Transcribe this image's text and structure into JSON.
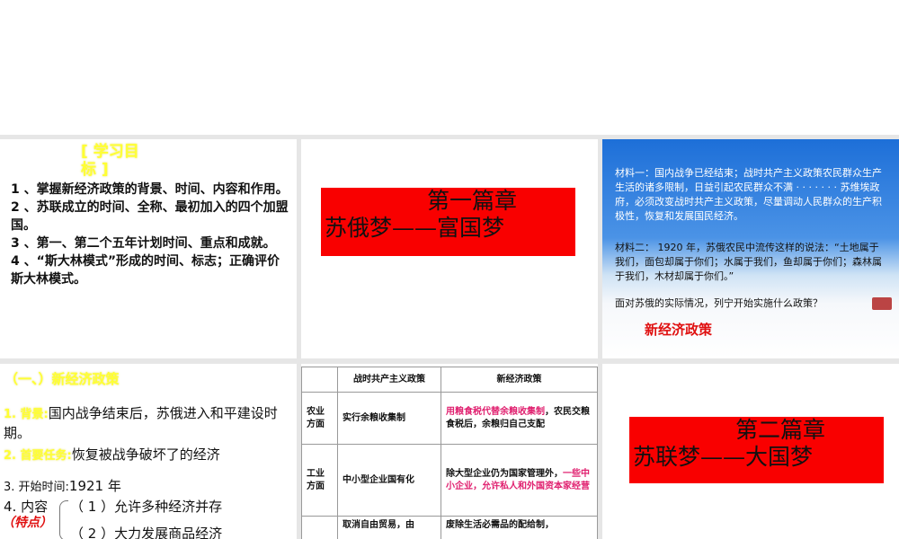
{
  "slide1": {
    "title": "[ 学习目标 ]",
    "goals": [
      "1 、掌握新经济政策的背景、时间、内容和作用。",
      "2 、苏联成立的时间、全称、最初加入的四个加盟国。",
      "3 、第一、第二个五年计划时间、重点和成就。",
      "4 、“斯大林模式”形成的时间、标志；正确评价斯大林模式。"
    ]
  },
  "slide2": {
    "line1": "第一篇章",
    "line2": "苏俄梦——富国梦"
  },
  "slide3": {
    "material1": "材料一：国内战争已经结束；战时共产主义政策农民群众生产生活的诸多限制，日益引起农民群众不满 · · · · · · · 苏维埃政府，必须改变战时共产主义政策，尽量调动人民群众的生产积极性，恢复和发展国民经济。",
    "material2": "材料二： 1920 年，苏俄农民中流传这样的说法：“土地属于我们，面包却属于你们；水属于我们，鱼却属于你们；森林属于我们，木材却属于你们。”",
    "question": "面对苏俄的实际情况，列宁开始实施什么政策？",
    "answer": "新经济政策"
  },
  "slide4": {
    "heading": "（一、）新经济政策",
    "bg_label": "1. 背景:",
    "bg_text": "国内战争结束后，苏俄进入和平建设时期。",
    "task_label": "2. 首要任务:",
    "task_text": "恢复被战争破坏了的经济",
    "start_label": "3. 开始时间:",
    "start_text": "1921 年",
    "content_label": "4. 内容",
    "feature_label": "（特点）",
    "items": [
      "（ 1 ）允许多种经济并存",
      "（ 2 ）大力发展商品经济"
    ]
  },
  "slide5": {
    "headers": [
      "",
      "战时共产主义政策",
      "新经济政策"
    ],
    "rows": [
      {
        "aspect": "农业方面",
        "war": "实行余粮收集制",
        "nep_hl": "用粮食税代替余粮收集制",
        "nep": "，农民交粮食税后，余粮归自己支配",
        "nep_pre": ""
      },
      {
        "aspect": "工业方面",
        "war": "中小型企业国有化",
        "nep_pre": "除大型企业仍为国家管理外，",
        "nep_hl": "一些中小企业，允许私人和外国资本家经营",
        "nep": ""
      },
      {
        "aspect": "",
        "war": "取消自由贸易，由",
        "nep_pre": "废除生活必需品的配给制，",
        "nep_hl": "",
        "nep": ""
      }
    ]
  },
  "slide6": {
    "line1": "第二篇章",
    "line2": "苏联梦——大国梦"
  }
}
